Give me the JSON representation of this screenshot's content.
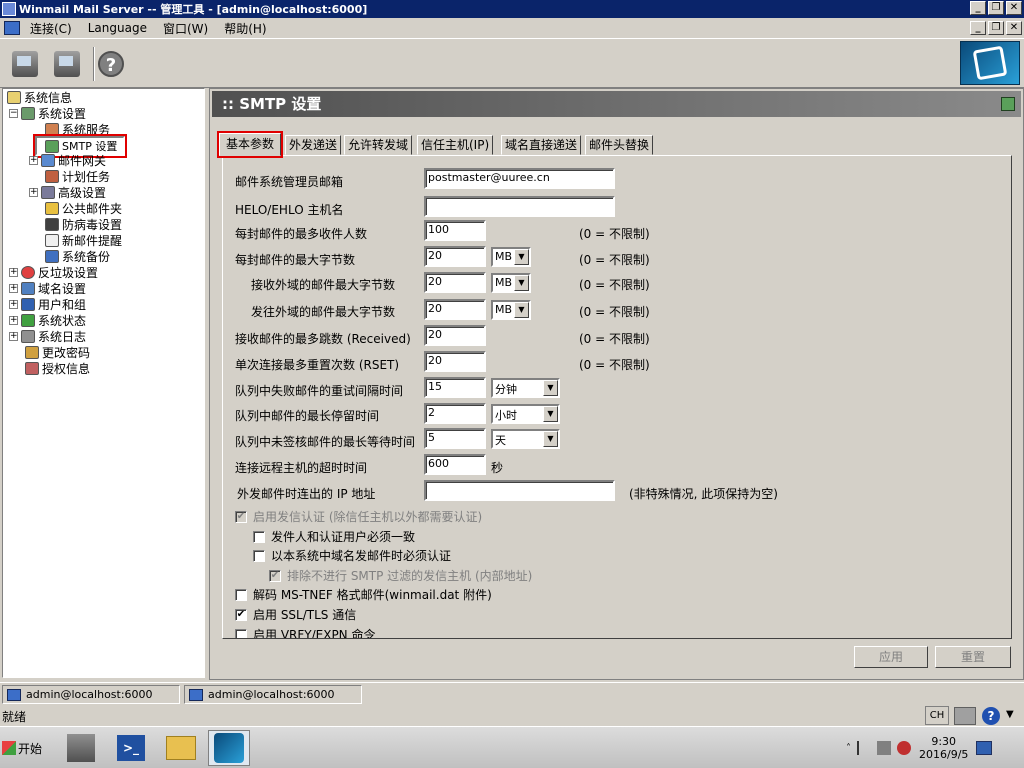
{
  "window": {
    "title": "Winmail Mail Server -- 管理工具 - [admin@localhost:6000]"
  },
  "menu": {
    "items": [
      "连接(C)",
      "Language",
      "窗口(W)",
      "帮助(H)"
    ]
  },
  "tree": {
    "nodes": [
      {
        "label": "系统信息"
      },
      {
        "label": "系统设置"
      },
      {
        "label": "系统服务"
      },
      {
        "label": "SMTP 设置"
      },
      {
        "label": "邮件网关"
      },
      {
        "label": "计划任务"
      },
      {
        "label": "高级设置"
      },
      {
        "label": "公共邮件夹"
      },
      {
        "label": "防病毒设置"
      },
      {
        "label": "新邮件提醒"
      },
      {
        "label": "系统备份"
      },
      {
        "label": "反垃圾设置"
      },
      {
        "label": "域名设置"
      },
      {
        "label": "用户和组"
      },
      {
        "label": "系统状态"
      },
      {
        "label": "系统日志"
      },
      {
        "label": "更改密码"
      },
      {
        "label": "授权信息"
      }
    ]
  },
  "panel": {
    "title": ":: SMTP 设置"
  },
  "tabs": [
    "基本参数",
    "外发递送",
    "允许转发域",
    "信任主机(IP)",
    "域名直接递送",
    "邮件头替换"
  ],
  "form": {
    "admin_email": {
      "label": "邮件系统管理员邮箱",
      "value": "postmaster@uuree.cn"
    },
    "helo": {
      "label": "HELO/EHLO 主机名",
      "value": ""
    },
    "max_rcpt": {
      "label": "每封邮件的最多收件人数",
      "value": "100",
      "hint": "(0 = 不限制)"
    },
    "max_size": {
      "label": "每封邮件的最大字节数",
      "value": "20",
      "unit": "MB",
      "hint": "(0 = 不限制)"
    },
    "max_size_in": {
      "label": "接收外域的邮件最大字节数",
      "value": "20",
      "unit": "MB",
      "hint": "(0 = 不限制)"
    },
    "max_size_out": {
      "label": "发往外域的邮件最大字节数",
      "value": "20",
      "unit": "MB",
      "hint": "(0 = 不限制)"
    },
    "max_hops": {
      "label": "接收邮件的最多跳数 (Received)",
      "value": "20",
      "hint": "(0 = 不限制)"
    },
    "max_rset": {
      "label": "单次连接最多重置次数 (RSET)",
      "value": "20",
      "hint": "(0 = 不限制)"
    },
    "retry_interval": {
      "label": "队列中失败邮件的重试间隔时间",
      "value": "15",
      "unit": "分钟"
    },
    "max_stay": {
      "label": "队列中邮件的最长停留时间",
      "value": "2",
      "unit": "小时"
    },
    "max_wait": {
      "label": "队列中未签核邮件的最长等待时间",
      "value": "5",
      "unit": "天"
    },
    "timeout": {
      "label": "连接远程主机的超时时间",
      "value": "600",
      "unit": "秒"
    },
    "out_ip": {
      "label": "外发邮件时连出的 IP 地址",
      "value": "",
      "hint": "(非特殊情况, 此项保持为空)"
    },
    "cb_auth": {
      "label": "启用发信认证 (除信任主机以外都需要认证)",
      "checked": "✔"
    },
    "cb_sender": {
      "label": "发件人和认证用户必须一致",
      "checked": ""
    },
    "cb_domain": {
      "label": "以本系统中域名发邮件时必须认证",
      "checked": ""
    },
    "cb_exclude": {
      "label": "排除不进行 SMTP 过滤的发信主机 (内部地址)",
      "checked": "✔"
    },
    "cb_tnef": {
      "label": "解码 MS-TNEF 格式邮件(winmail.dat 附件)",
      "checked": ""
    },
    "cb_ssl": {
      "label": "启用 SSL/TLS 通信",
      "checked": "✔"
    },
    "cb_vrfy": {
      "label": "启用 VRFY/EXPN 命令",
      "checked": ""
    }
  },
  "buttons": {
    "apply": "应用",
    "reset": "重置"
  },
  "docbar": {
    "tab1": "admin@localhost:6000",
    "tab2": "admin@localhost:6000"
  },
  "status": {
    "text": "就绪",
    "ime": "CH"
  },
  "taskbar": {
    "start": "开始",
    "time": "9:30",
    "date": "2016/9/5"
  }
}
